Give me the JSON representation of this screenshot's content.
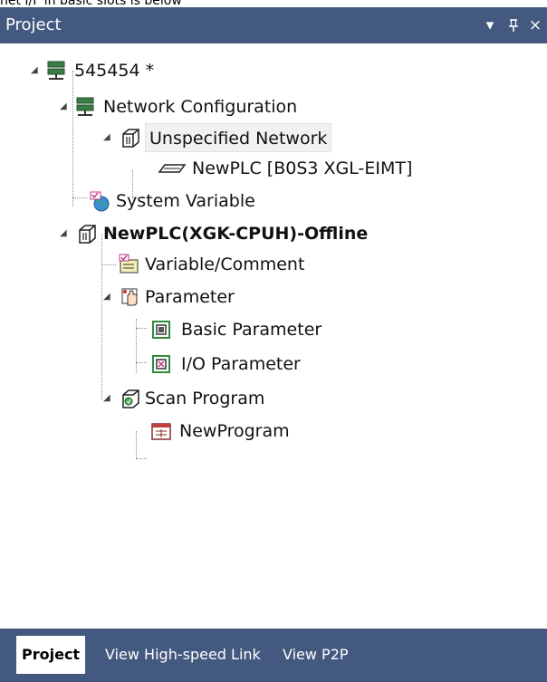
{
  "caption": "net I/F in basic slots is below",
  "titlebar": {
    "title": "Project",
    "dropdown_glyph": "▾",
    "pin_glyph": "ꟷ",
    "close_glyph": "×"
  },
  "tree": {
    "root": {
      "label": "545454 *",
      "icon": "project-network-icon"
    },
    "network_configuration": {
      "label": "Network Configuration",
      "icon": "network-config-icon"
    },
    "unspecified_network": {
      "label": "Unspecified Network",
      "icon": "network-box-icon"
    },
    "newplc_module": {
      "label": "NewPLC [B0S3 XGL-EIMT]",
      "icon": "module-card-icon"
    },
    "system_variable": {
      "label": "System Variable",
      "icon": "globe-variable-icon"
    },
    "plc": {
      "label": "NewPLC(XGK-CPUH)-Offline",
      "icon": "plc-box-icon"
    },
    "variable_comment": {
      "label": "Variable/Comment",
      "icon": "variable-comment-icon"
    },
    "parameter": {
      "label": "Parameter",
      "icon": "hand-parameter-icon"
    },
    "basic_parameter": {
      "label": "Basic Parameter",
      "icon": "basic-parameter-icon"
    },
    "io_parameter": {
      "label": "I/O Parameter",
      "icon": "io-parameter-icon"
    },
    "scan_program": {
      "label": "Scan Program",
      "icon": "scan-program-icon"
    },
    "new_program": {
      "label": "NewProgram",
      "icon": "program-icon"
    }
  },
  "tabs": [
    {
      "label": "Project",
      "active": true
    },
    {
      "label": "View High-speed Link",
      "active": false
    },
    {
      "label": "View P2P",
      "active": false
    }
  ],
  "colors": {
    "titlebar": "#44597f",
    "selected_row": "#f1f1f1"
  }
}
